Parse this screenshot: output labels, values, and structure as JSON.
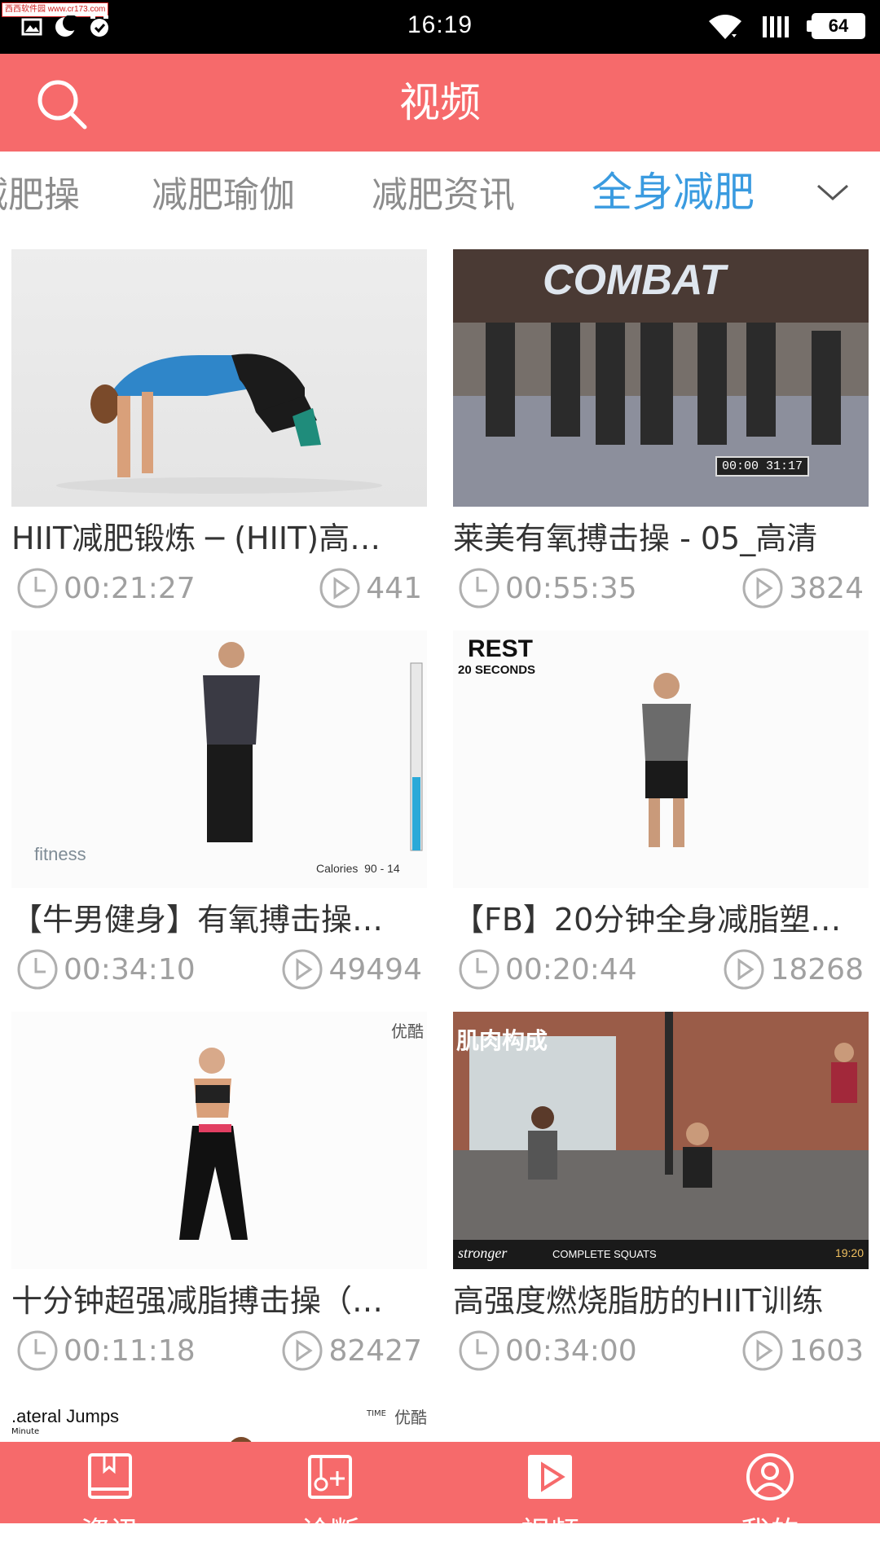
{
  "status_bar": {
    "watermark": "西西软件园 www.cr173.com",
    "time": "16:19",
    "battery": "64"
  },
  "header": {
    "title": "视频"
  },
  "tabs": [
    {
      "label": "减肥操"
    },
    {
      "label": "减肥瑜伽"
    },
    {
      "label": "减肥资讯"
    },
    {
      "label": "全身减肥",
      "active": true
    }
  ],
  "videos": [
    {
      "title": "HIIT减肥锻炼 ─ (HIIT)高…",
      "duration": "00:21:27",
      "plays": "441",
      "overlay": ""
    },
    {
      "title": "莱美有氧搏击操 - 05_高清",
      "duration": "00:55:35",
      "plays": "3824",
      "overlay": "COMBAT",
      "timestamp": "00:00 31:17"
    },
    {
      "title": "【牛男健身】有氧搏击操…",
      "duration": "00:34:10",
      "plays": "49494",
      "overlay": "fitness",
      "overlay2": "Calories  90 - 14"
    },
    {
      "title": "【FB】20分钟全身减脂塑…",
      "duration": "00:20:44",
      "plays": "18268",
      "overlay": "REST",
      "overlay2": "20 SECONDS"
    },
    {
      "title": "十分钟超强减脂搏击操（…",
      "duration": "00:11:18",
      "plays": "82427",
      "overlay": "优酷"
    },
    {
      "title": "高强度燃烧脂肪的HIIT训练",
      "duration": "00:34:00",
      "plays": "1603",
      "overlay": "肌肉构成",
      "overlay2": "COMPLETE SQUATS",
      "overlay3": "stronger",
      "timestamp": "19:20"
    }
  ],
  "partial_card": {
    "label": ".ateral Jumps",
    "sub": "Minute",
    "corner": "TIME"
  },
  "bottom_nav": [
    {
      "label": "资讯",
      "icon": "book-icon"
    },
    {
      "label": "诊断",
      "icon": "diagnosis-icon"
    },
    {
      "label": "视频",
      "icon": "video-icon",
      "active": true
    },
    {
      "label": "我的",
      "icon": "user-icon"
    }
  ],
  "colors": {
    "accent": "#f66a6b",
    "tab_active": "#3a9be0",
    "meta_text": "#a0a0a0"
  }
}
